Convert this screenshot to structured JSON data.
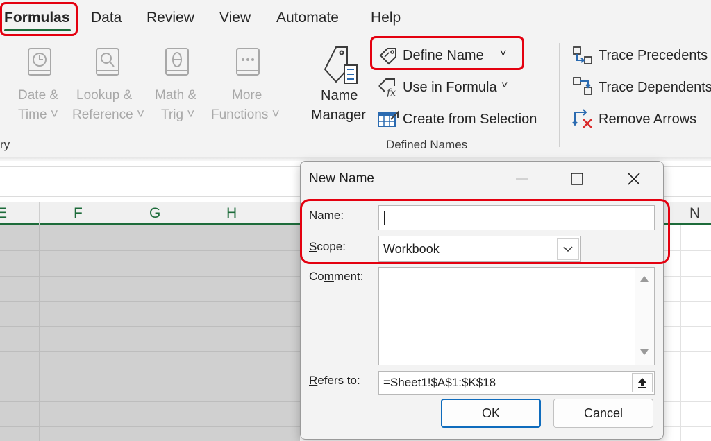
{
  "tabs": [
    "Formulas",
    "Data",
    "Review",
    "View",
    "Automate",
    "Help"
  ],
  "ribbon": {
    "functions": [
      {
        "label1": "Date &",
        "label2": "Time ˅",
        "icon": "clock-book-icon"
      },
      {
        "label1": "Lookup &",
        "label2": "Reference ˅",
        "icon": "magnifier-book-icon"
      },
      {
        "label1": "Math &",
        "label2": "Trig ˅",
        "icon": "theta-book-icon"
      },
      {
        "label1": "More",
        "label2": "Functions ˅",
        "icon": "dots-book-icon"
      }
    ],
    "library_group_label": "ry",
    "name_manager": {
      "label1": "Name",
      "label2": "Manager"
    },
    "define_name": "Define Name",
    "define_name_arrow": "˅",
    "use_in_formula": "Use in Formula",
    "use_in_formula_arrow": "˅",
    "create_from_selection": "Create from Selection",
    "defined_names_label": "Defined Names",
    "trace_precedents": "Trace Precedents",
    "trace_dependents": "Trace Dependents",
    "remove_arrows": "Remove Arrows"
  },
  "columns": [
    "E",
    "F",
    "G",
    "H",
    "N"
  ],
  "dialog": {
    "title": "New Name",
    "name_label_u": "N",
    "name_label_rest": "ame:",
    "name_value": "",
    "scope_label_u": "S",
    "scope_label_rest": "cope:",
    "scope_value": "Workbook",
    "comment_label_pre": "Co",
    "comment_label_u": "m",
    "comment_label_rest": "ment:",
    "comment_value": "",
    "refers_label_u": "R",
    "refers_label_rest": "efers to:",
    "refers_value": "=Sheet1!$A$1:$K$18",
    "ok": "OK",
    "cancel": "Cancel"
  },
  "colors": {
    "accent_green": "#1d6b3a",
    "highlight_red": "#e4000f",
    "ok_border": "#0f6cbd"
  }
}
